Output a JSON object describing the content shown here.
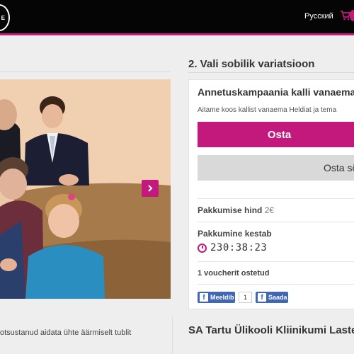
{
  "header": {
    "logo_text": "E",
    "language_link": "Русский",
    "cart_icon": "cart-icon"
  },
  "gallery": {
    "next_icon": "chevron-right-icon"
  },
  "campaign": {
    "description": "otsustanud aidata ühte äärmiselt tublit"
  },
  "variation": {
    "step_title": "2. Vali sobilik variatsioon",
    "title": "Annetuskampaania kalli vanaema l",
    "subtitle": "Aitame koos kallist vanaema Heldiat ja tema",
    "buy_label": "Osta",
    "gift_label": "Osta sõ",
    "price_label": "Pakkumise hind",
    "price_value": "2€",
    "duration_label": "Pakkumine kestab",
    "timer": "230:38:23",
    "vouchers_sold": "1 voucherit ostetud"
  },
  "social": {
    "like_label": "Meeldib",
    "like_count": "1",
    "share_label": "Saada"
  },
  "organization": {
    "title": "SA Tartu Ülikooli Kliinikumi Lastefo"
  },
  "colors": {
    "accent": "#c4197c",
    "header_bg": "#050505",
    "facebook": "#4267b2",
    "page_bg": "#eeeeee"
  }
}
